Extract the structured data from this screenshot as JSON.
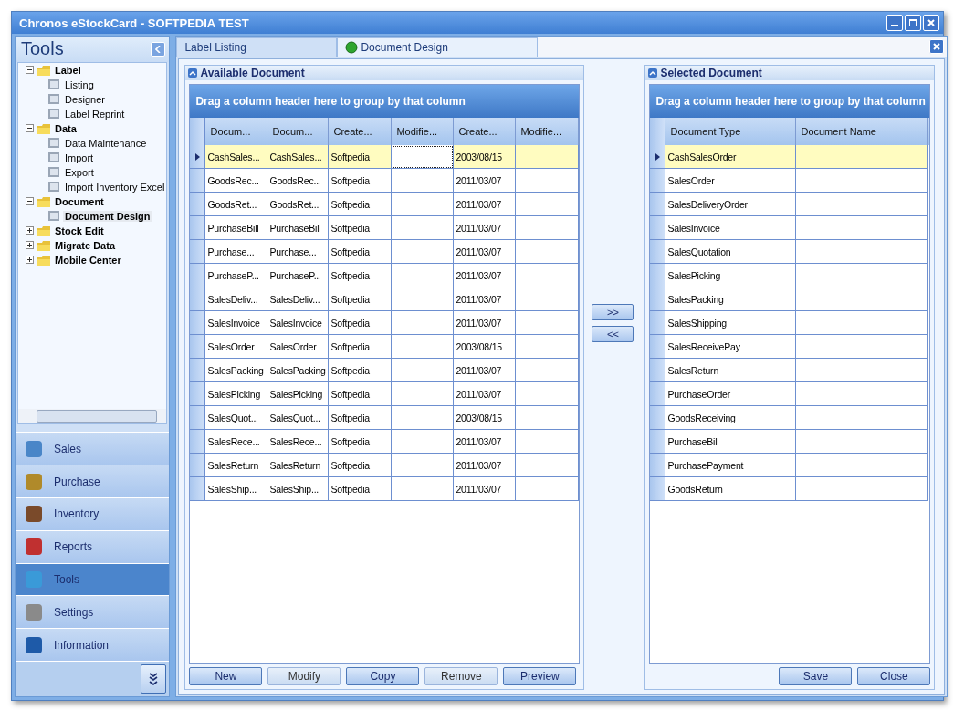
{
  "window": {
    "title": "Chronos eStockCard - SOFTPEDIA TEST"
  },
  "sidebar": {
    "title": "Tools",
    "tree": [
      {
        "label": "Label",
        "expanded": true,
        "selected": false,
        "children": [
          {
            "label": "Listing",
            "selected": false
          },
          {
            "label": "Designer",
            "selected": false
          },
          {
            "label": "Label Reprint",
            "selected": false
          }
        ]
      },
      {
        "label": "Data",
        "expanded": true,
        "selected": false,
        "children": [
          {
            "label": "Data Maintenance",
            "selected": false
          },
          {
            "label": "Import",
            "selected": false
          },
          {
            "label": "Export",
            "selected": false
          },
          {
            "label": "Import Inventory Excel",
            "selected": false
          }
        ]
      },
      {
        "label": "Document",
        "expanded": true,
        "selected": false,
        "children": [
          {
            "label": "Document Design",
            "selected": true
          }
        ]
      },
      {
        "label": "Stock Edit",
        "expanded": false,
        "selected": false
      },
      {
        "label": "Migrate Data",
        "expanded": false,
        "selected": false
      },
      {
        "label": "Mobile Center",
        "expanded": false,
        "selected": false
      }
    ],
    "nav": [
      {
        "label": "Sales",
        "selected": false
      },
      {
        "label": "Purchase",
        "selected": false
      },
      {
        "label": "Inventory",
        "selected": false
      },
      {
        "label": "Reports",
        "selected": false
      },
      {
        "label": "Tools",
        "selected": true
      },
      {
        "label": "Settings",
        "selected": false
      },
      {
        "label": "Information",
        "selected": false
      }
    ]
  },
  "tabs": [
    {
      "label": "Label Listing",
      "selected": false
    },
    {
      "label": "Document Design",
      "selected": true
    }
  ],
  "available": {
    "title": "Available Document",
    "group_hint": "Drag a column header here to group by that column",
    "columns": [
      "Docum...",
      "Docum...",
      "Create...",
      "Modifie...",
      "Create...",
      "Modifie..."
    ],
    "rows": [
      {
        "column_1": "CashSales...",
        "column_2": "CashSales...",
        "column_3": "Softpedia",
        "column_5": "2003/08/15",
        "selected": true
      },
      {
        "column_1": "GoodsRec...",
        "column_2": "GoodsRec...",
        "column_3": "Softpedia",
        "column_5": "2011/03/07",
        "selected": false
      },
      {
        "column_1": "GoodsRet...",
        "column_2": "GoodsRet...",
        "column_3": "Softpedia",
        "column_5": "2011/03/07",
        "selected": false
      },
      {
        "column_1": "PurchaseBill",
        "column_2": "PurchaseBill",
        "column_3": "Softpedia",
        "column_5": "2011/03/07",
        "selected": false
      },
      {
        "column_1": "Purchase...",
        "column_2": "Purchase...",
        "column_3": "Softpedia",
        "column_5": "2011/03/07",
        "selected": false
      },
      {
        "column_1": "PurchaseP...",
        "column_2": "PurchaseP...",
        "column_3": "Softpedia",
        "column_5": "2011/03/07",
        "selected": false
      },
      {
        "column_1": "SalesDeliv...",
        "column_2": "SalesDeliv...",
        "column_3": "Softpedia",
        "column_5": "2011/03/07",
        "selected": false
      },
      {
        "column_1": "SalesInvoice",
        "column_2": "SalesInvoice",
        "column_3": "Softpedia",
        "column_5": "2011/03/07",
        "selected": false
      },
      {
        "column_1": "SalesOrder",
        "column_2": "SalesOrder",
        "column_3": "Softpedia",
        "column_5": "2003/08/15",
        "selected": false
      },
      {
        "column_1": "SalesPacking",
        "column_2": "SalesPacking",
        "column_3": "Softpedia",
        "column_5": "2011/03/07",
        "selected": false
      },
      {
        "column_1": "SalesPicking",
        "column_2": "SalesPicking",
        "column_3": "Softpedia",
        "column_5": "2011/03/07",
        "selected": false
      },
      {
        "column_1": "SalesQuot...",
        "column_2": "SalesQuot...",
        "column_3": "Softpedia",
        "column_5": "2003/08/15",
        "selected": false
      },
      {
        "column_1": "SalesRece...",
        "column_2": "SalesRece...",
        "column_3": "Softpedia",
        "column_5": "2011/03/07",
        "selected": false
      },
      {
        "column_1": "SalesReturn",
        "column_2": "SalesReturn",
        "column_3": "Softpedia",
        "column_5": "2011/03/07",
        "selected": false
      },
      {
        "column_1": "SalesShip...",
        "column_2": "SalesShip...",
        "column_3": "Softpedia",
        "column_5": "2011/03/07",
        "selected": false
      }
    ],
    "buttons": [
      {
        "label": "New",
        "disabled": false
      },
      {
        "label": "Modify",
        "disabled": true
      },
      {
        "label": "Copy",
        "disabled": false
      },
      {
        "label": "Remove",
        "disabled": true
      },
      {
        "label": "Preview",
        "disabled": false
      }
    ]
  },
  "transfer_buttons": [
    ">>",
    "<<"
  ],
  "selected": {
    "title": "Selected Document",
    "group_hint": "Drag a column header here to group by that column",
    "columns": [
      "Document Type",
      "Document Name"
    ],
    "rows": [
      {
        "document_type": "CashSalesOrder",
        "selected": true
      },
      {
        "document_type": "SalesOrder",
        "selected": false
      },
      {
        "document_type": "SalesDeliveryOrder",
        "selected": false
      },
      {
        "document_type": "SalesInvoice",
        "selected": false
      },
      {
        "document_type": "SalesQuotation",
        "selected": false
      },
      {
        "document_type": "SalesPicking",
        "selected": false
      },
      {
        "document_type": "SalesPacking",
        "selected": false
      },
      {
        "document_type": "SalesShipping",
        "selected": false
      },
      {
        "document_type": "SalesReceivePay",
        "selected": false
      },
      {
        "document_type": "SalesReturn",
        "selected": false
      },
      {
        "document_type": "PurchaseOrder",
        "selected": false
      },
      {
        "document_type": "GoodsReceiving",
        "selected": false
      },
      {
        "document_type": "PurchaseBill",
        "selected": false
      },
      {
        "document_type": "PurchasePayment",
        "selected": false
      },
      {
        "document_type": "GoodsReturn",
        "selected": false
      }
    ],
    "buttons": [
      {
        "label": "Save",
        "disabled": false
      },
      {
        "label": "Close",
        "disabled": false
      }
    ]
  }
}
